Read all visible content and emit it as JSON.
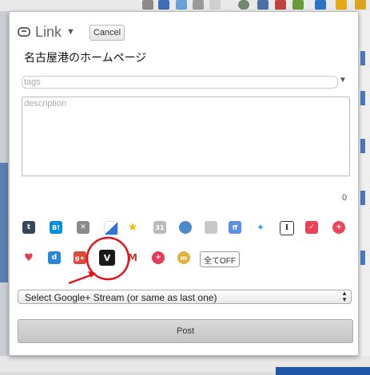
{
  "popup": {
    "type_label": "Link",
    "cancel_label": "Cancel",
    "page_title": "名古屋港のホームページ",
    "tags_placeholder": "tags",
    "description_placeholder": "description",
    "char_count": "0",
    "services_row1": [
      "tumblr-icon",
      "hatena-bookmark-icon",
      "pinboard-icon",
      "delicious-icon",
      "favorite-star-icon",
      "calendar-31-icon",
      "chrome-icon",
      "evernote-icon",
      "friendfeed-icon",
      "twitter-icon",
      "instapaper-icon",
      "pocket-icon",
      "add-service-icon"
    ],
    "services_row2": [
      "location-pin-icon",
      "diigo-icon",
      "google-plus-icon",
      "selected-service-icon",
      "gmail-icon",
      "plus-cross-icon",
      "m-service-icon"
    ],
    "all_off_label": "全てOFF",
    "stream_select": "Select Google+ Stream (or same as last one)",
    "post_label": "Post"
  },
  "colors": {
    "annotation_red": "#e2141c"
  }
}
